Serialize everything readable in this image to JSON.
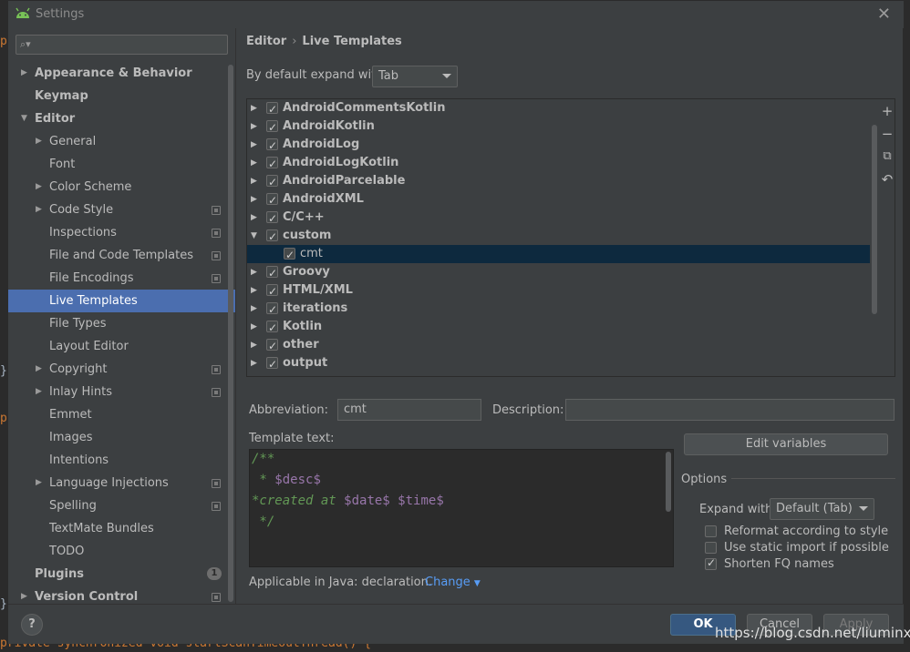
{
  "window": {
    "title": "Settings"
  },
  "search": {
    "placeholder": ""
  },
  "sidebar": {
    "items": [
      {
        "label": "Appearance & Behavior"
      },
      {
        "label": "Keymap"
      },
      {
        "label": "Editor"
      },
      {
        "label": "General"
      },
      {
        "label": "Font"
      },
      {
        "label": "Color Scheme"
      },
      {
        "label": "Code Style"
      },
      {
        "label": "Inspections"
      },
      {
        "label": "File and Code Templates"
      },
      {
        "label": "File Encodings"
      },
      {
        "label": "Live Templates"
      },
      {
        "label": "File Types"
      },
      {
        "label": "Layout Editor"
      },
      {
        "label": "Copyright"
      },
      {
        "label": "Inlay Hints"
      },
      {
        "label": "Emmet"
      },
      {
        "label": "Images"
      },
      {
        "label": "Intentions"
      },
      {
        "label": "Language Injections"
      },
      {
        "label": "Spelling"
      },
      {
        "label": "TextMate Bundles"
      },
      {
        "label": "TODO"
      },
      {
        "label": "Plugins",
        "badge": "1"
      },
      {
        "label": "Version Control"
      }
    ]
  },
  "breadcrumb": {
    "parent": "Editor",
    "separator": "›",
    "current": "Live Templates"
  },
  "expand": {
    "label": "By default expand with",
    "value": "Tab"
  },
  "templates": [
    {
      "label": "AndroidCommentsKotlin"
    },
    {
      "label": "AndroidKotlin"
    },
    {
      "label": "AndroidLog"
    },
    {
      "label": "AndroidLogKotlin"
    },
    {
      "label": "AndroidParcelable"
    },
    {
      "label": "AndroidXML"
    },
    {
      "label": "C/C++"
    },
    {
      "label": "custom"
    },
    {
      "label": "cmt"
    },
    {
      "label": "Groovy"
    },
    {
      "label": "HTML/XML"
    },
    {
      "label": "iterations"
    },
    {
      "label": "Kotlin"
    },
    {
      "label": "other"
    },
    {
      "label": "output"
    }
  ],
  "toolbar": {
    "add": "+",
    "remove": "−",
    "copy": "⧉",
    "revert": "↶"
  },
  "abbreviation": {
    "label": "Abbreviation:",
    "value": "cmt"
  },
  "description": {
    "label": "Description:",
    "value": ""
  },
  "template_text": {
    "label": "Template text:",
    "line1": "/**",
    "line2_prefix": " * ",
    "line2_var": "$desc$",
    "line3_prefix": "*created at ",
    "line3_var1": "$date$",
    "line3_space": " ",
    "line3_var2": "$time$",
    "line4": " */"
  },
  "edit_variables": "Edit variables",
  "options": {
    "title": "Options",
    "expand_label": "Expand with",
    "expand_value": "Default (Tab)",
    "reformat": "Reformat according to style",
    "static_import": "Use static import if possible",
    "shorten_fq": "Shorten FQ names"
  },
  "applicable": {
    "text": "Applicable in Java: declaration.",
    "change": "Change"
  },
  "footer": {
    "help": "?",
    "ok": "OK",
    "cancel": "Cancel",
    "apply": "Apply"
  },
  "background_code": {
    "bottom_line": "private synchronized void startScanTimeoutThread() {"
  },
  "watermark": "https://blog.csdn.net/liuminx"
}
